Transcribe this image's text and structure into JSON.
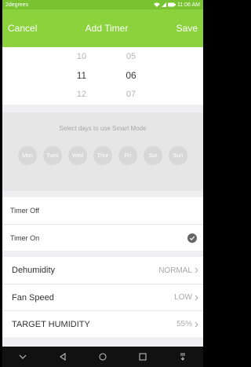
{
  "status": {
    "carrier": "2degrees",
    "icons": [
      "wifi-icon",
      "signal-icon",
      "battery-icon"
    ],
    "time": "11:06 AM"
  },
  "topbar": {
    "cancel": "Cancel",
    "title": "Add Timer",
    "save": "Save"
  },
  "picker": {
    "hours": [
      "10",
      "11",
      "12"
    ],
    "minutes": [
      "05",
      "06",
      "07"
    ]
  },
  "days": {
    "hint": "Select days to use Smart Mode",
    "items": [
      "Mon",
      "Tues",
      "Wed",
      "Thur",
      "Fri",
      "Sat",
      "Sun"
    ]
  },
  "timer": {
    "off_label": "Timer Off",
    "on_label": "Timer On"
  },
  "settings": [
    {
      "label": "Dehumidity",
      "value": "NORMAL"
    },
    {
      "label": "Fan Speed",
      "value": "LOW"
    },
    {
      "label": "TARGET HUMIDITY",
      "value": "55%"
    }
  ],
  "nav": {
    "icons": [
      "chevron-down-icon",
      "back-icon",
      "home-icon",
      "recents-icon",
      "notification-pull-icon"
    ]
  },
  "colors": {
    "accent": "#8cd23d",
    "status": "#79c331",
    "check": "#666666"
  }
}
